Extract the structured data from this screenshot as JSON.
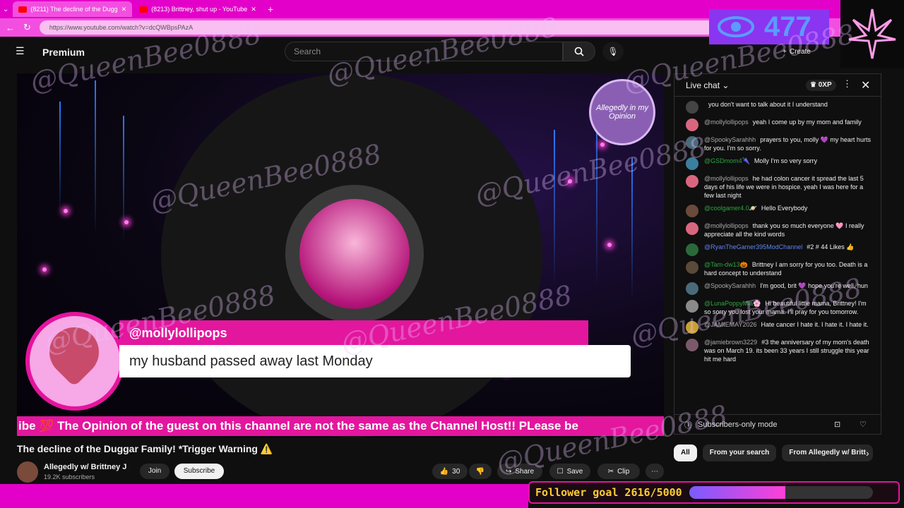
{
  "browser": {
    "tabs": [
      {
        "title": "(8211) The decline of the Dugg"
      },
      {
        "title": "(8213) Brittney, shut up - YouTube"
      }
    ],
    "url": "https://www.youtube.com/watch?v=dcQWBpsPAzA"
  },
  "header": {
    "logo_text": "Premium",
    "search_placeholder": "Search",
    "create_label": "Create"
  },
  "overlay": {
    "viewer_count": "477",
    "watermark": "@QueenBee0888",
    "badge_text": "Allegedly in my Opinion",
    "name": "@mollylollipops",
    "message": "my husband passed away last Monday",
    "ticker": "ibe 💯 The Opinion of the guest on this channel are not the same as the Channel Host!! PLease be",
    "follower_goal_text": "Follower goal 2616/5000",
    "follower_goal_fraction": 0.5232
  },
  "video": {
    "title": "The decline of the Duggar Family! *Trigger Warning ⚠️",
    "channel": "Allegedly w/ Brittney J",
    "subscribers": "19.2K subscribers",
    "join_label": "Join",
    "subscribe_label": "Subscribe",
    "likes": "30",
    "share_label": "Share",
    "save_label": "Save",
    "clip_label": "Clip"
  },
  "chat": {
    "header": "Live chat",
    "xp": "0XP",
    "messages": [
      {
        "author": "",
        "text": "you don't want to talk about it I understand",
        "color": "#aaa",
        "avatar": "#444"
      },
      {
        "author": "@mollylollipops",
        "text": "yeah I come up by my mom and family",
        "color": "#aaa",
        "avatar": "#d9667f"
      },
      {
        "author": "@SpookySarahhh",
        "text": "prayers to you, molly 💜 my heart hurts for you. I'm so sorry.",
        "color": "#aaa",
        "avatar": "#4a6a7a"
      },
      {
        "author": "@GSDmom4🌂",
        "text": "Molly I'm so very sorry",
        "color": "#2ba640",
        "avatar": "#3b7fa0"
      },
      {
        "author": "@mollylollipops",
        "text": "he had colon cancer it spread the last 5 days of his life we were in hospice. yeah I was here for a few last night",
        "color": "#aaa",
        "avatar": "#d9667f"
      },
      {
        "author": "@coolgamer4.0🪐",
        "text": "Hello Everybody",
        "color": "#2ba640",
        "avatar": "#6a4a3a"
      },
      {
        "author": "@mollylollipops",
        "text": "thank you so much everyone 🩷 I really appreciate all the kind words",
        "color": "#aaa",
        "avatar": "#d9667f"
      },
      {
        "author": "@RyanTheGamer395ModChannel",
        "text": "#2 # 44 Likes 👍",
        "color": "#5e84f1",
        "avatar": "#2a6a3a"
      },
      {
        "author": "@Tam-dw13🎃",
        "text": "Brittney I am sorry for you too. Death is a hard concept to understand",
        "color": "#2ba640",
        "avatar": "#5a4a3a"
      },
      {
        "author": "@SpookySarahhh",
        "text": "I'm good, brit 💜 hope you're well, hun",
        "color": "#aaa",
        "avatar": "#4a6a7a"
      },
      {
        "author": "@LunaPoppyMia🌸",
        "text": "Hi beautiful little mama, Brittney! I'm so sorry you lost your mama. I'll pray for you tomorrow.",
        "color": "#2ba640",
        "avatar": "#8a8a8a"
      },
      {
        "author": "@JAMIEMAY2026",
        "text": "Hate cancer I hate it. I hate it. I hate it.",
        "color": "#aaa",
        "avatar": "#c9a030"
      },
      {
        "author": "@jamiebrown3229",
        "text": "#3 the anniversary of my mom's death was on March 19. its been 33 years I still struggle this year hit me hard",
        "color": "#aaa",
        "avatar": "#7a5a6a"
      }
    ],
    "footer": "Subscribers-only mode"
  },
  "chips": [
    "All",
    "From your search",
    "From Allegedly w/ Britt"
  ],
  "colors": {
    "accent": "#e300c8",
    "ticker": "#e3169e",
    "goal_text": "#ffcc33"
  }
}
